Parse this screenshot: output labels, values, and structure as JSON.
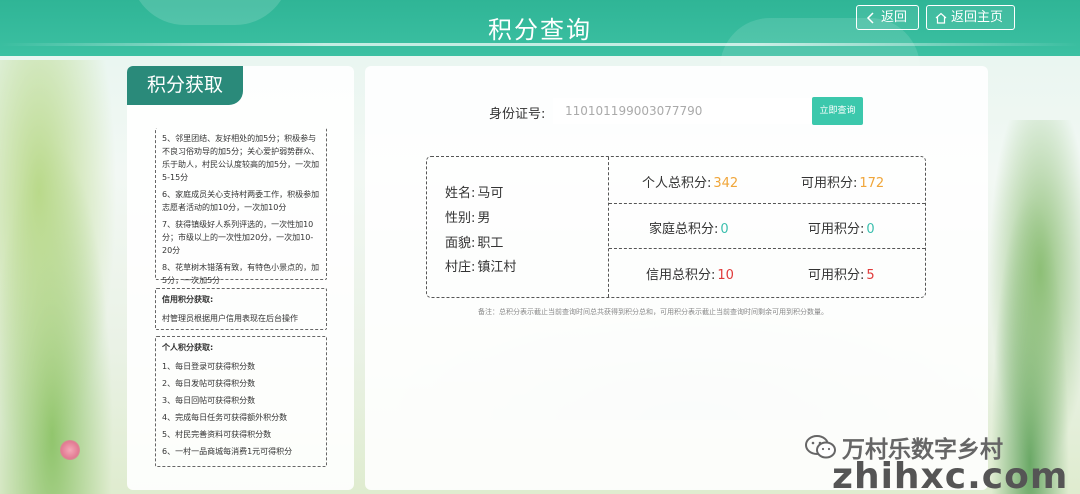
{
  "header": {
    "title": "积分查询",
    "back_label": "返回",
    "home_label": "返回主页"
  },
  "left": {
    "tab_title": "积分获取",
    "rules_top": [
      "5、邻里团结、友好相处的加5分；积极参与不良习俗劝导的加5分；关心爱护弱势群众、乐于助人，村民公认度较高的加5分，一次加5-15分",
      "6、家庭成员关心支持村两委工作，积极参加志愿者活动的加10分，一次加10分",
      "7、获得镇级好人系列评选的，一次性加10分；市级以上的一次性加20分，一次加10-20分",
      "8、花草树木错落有致，有特色小景点的，加5分，一次加5分"
    ],
    "credit": {
      "title": "信用积分获取:",
      "text": "村管理员根据用户信用表现在后台操作"
    },
    "personal": {
      "title": "个人积分获取:",
      "items": [
        "1、每日登录可获得积分数",
        "2、每日发帖可获得积分数",
        "3、每日回帖可获得积分数",
        "4、完成每日任务可获得额外积分数",
        "5、村民完善资料可获得积分数",
        "6、一村一品商城每消费1元可得积分"
      ]
    }
  },
  "query": {
    "id_label": "身份证号:",
    "id_value": "110101199003077790",
    "button_label": "立即查询"
  },
  "person": {
    "name_label": "姓名:",
    "name": "马可",
    "gender_label": "性别:",
    "gender": "男",
    "appearance_label": "面貌:",
    "appearance": "职工",
    "village_label": "村庄:",
    "village": "镇江村"
  },
  "scores": {
    "personal_total_label": "个人总积分:",
    "personal_total": "342",
    "personal_avail_label": "可用积分:",
    "personal_avail": "172",
    "family_total_label": "家庭总积分:",
    "family_total": "0",
    "family_avail_label": "可用积分:",
    "family_avail": "0",
    "credit_total_label": "信用总积分:",
    "credit_total": "10",
    "credit_avail_label": "可用积分:",
    "credit_avail": "5"
  },
  "note": "备注：总积分表示截止当前查询时间总共获得到积分总和，可用积分表示截止当前查询时间剩余可用到积分数量。",
  "watermark": {
    "line1": "万村乐数字乡村",
    "line2": "zhihxc.com"
  },
  "colors": {
    "header": "#2fb596",
    "tab": "#2a8a7a",
    "accent": "#3cc8ac",
    "orange": "#f0a63a",
    "teal": "#3cbfae",
    "red": "#e03b3b"
  }
}
